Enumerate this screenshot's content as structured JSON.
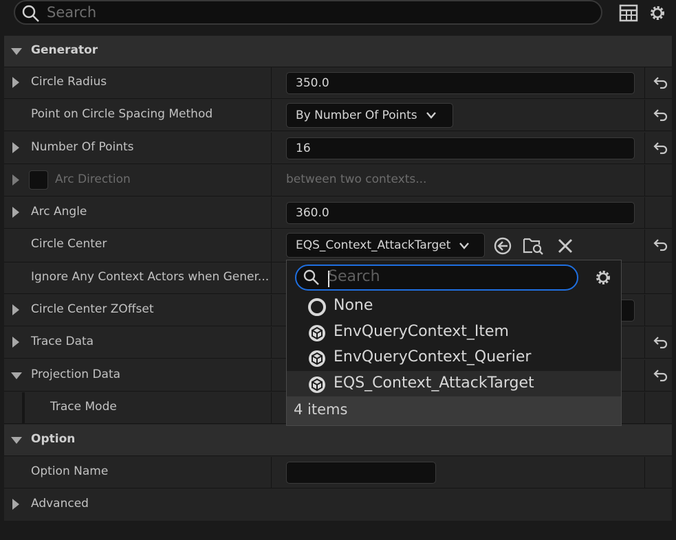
{
  "search": {
    "placeholder": "Search"
  },
  "categories": {
    "generator": "Generator",
    "option": "Option"
  },
  "rows": {
    "circle_radius": {
      "label": "Circle Radius",
      "value": "350.0"
    },
    "spacing_method": {
      "label": "Point on Circle Spacing Method",
      "value": "By Number Of Points"
    },
    "number_of_points": {
      "label": "Number Of Points",
      "value": "16"
    },
    "arc_direction": {
      "label": "Arc Direction",
      "value": "between two contexts..."
    },
    "arc_angle": {
      "label": "Arc Angle",
      "value": "360.0"
    },
    "circle_center": {
      "label": "Circle Center",
      "value": "EQS_Context_AttackTarget"
    },
    "ignore_context": {
      "label": "Ignore Any Context Actors when Gener..."
    },
    "zoffset": {
      "label": "Circle Center ZOffset"
    },
    "trace_data": {
      "label": "Trace Data"
    },
    "projection_data": {
      "label": "Projection Data"
    },
    "trace_mode": {
      "label": "Trace Mode"
    },
    "option_name": {
      "label": "Option Name",
      "value": ""
    },
    "advanced": {
      "label": "Advanced"
    }
  },
  "popup": {
    "search_placeholder": "Search",
    "items": [
      "None",
      "EnvQueryContext_Item",
      "EnvQueryContext_Querier",
      "EQS_Context_AttackTarget"
    ],
    "footer": "4 items"
  },
  "colors": {
    "focus": "#1f6fe0",
    "selected": "#2b2b2b"
  }
}
